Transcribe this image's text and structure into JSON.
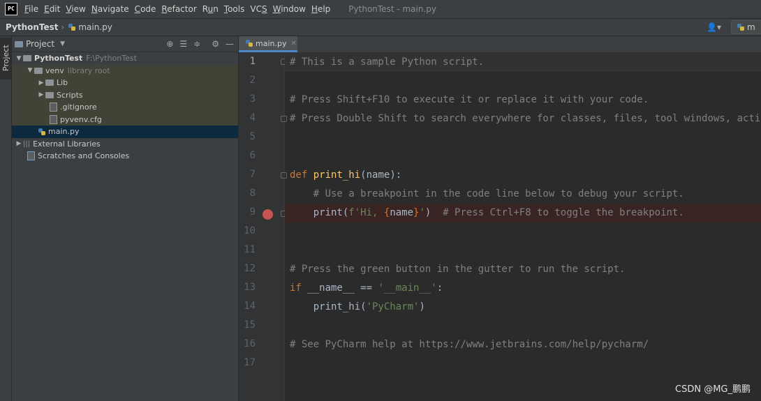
{
  "app": {
    "logo": "PC",
    "window_title": "PythonTest - main.py"
  },
  "menu": [
    {
      "label": "File",
      "mnemonic": "F"
    },
    {
      "label": "Edit",
      "mnemonic": "E"
    },
    {
      "label": "View",
      "mnemonic": "V"
    },
    {
      "label": "Navigate",
      "mnemonic": "N"
    },
    {
      "label": "Code",
      "mnemonic": "C"
    },
    {
      "label": "Refactor",
      "mnemonic": "R"
    },
    {
      "label": "Run",
      "mnemonic": "u"
    },
    {
      "label": "Tools",
      "mnemonic": "T"
    },
    {
      "label": "VCS",
      "mnemonic": "S"
    },
    {
      "label": "Window",
      "mnemonic": "W"
    },
    {
      "label": "Help",
      "mnemonic": "H"
    }
  ],
  "breadcrumb": {
    "project": "PythonTest",
    "file": "main.py"
  },
  "nav_right": {
    "user_icon": "user-icon",
    "run_config_partial": "m"
  },
  "stripe": {
    "project_tab": "Project"
  },
  "project_panel": {
    "title": "Project",
    "tools": [
      "target-icon",
      "expand-all-icon",
      "collapse-all-icon",
      "gear-icon",
      "hide-icon"
    ],
    "tree": [
      {
        "label": "PythonTest",
        "extra": "F:\\PythonTest",
        "kind": "folder",
        "bold": true
      },
      {
        "label": "venv",
        "extra": "library root",
        "kind": "folder"
      },
      {
        "label": "Lib",
        "kind": "folder"
      },
      {
        "label": "Scripts",
        "kind": "folder"
      },
      {
        "label": ".gitignore",
        "kind": "file"
      },
      {
        "label": "pyvenv.cfg",
        "kind": "file"
      },
      {
        "label": "main.py",
        "kind": "py"
      },
      {
        "label": "External Libraries",
        "kind": "libraries"
      },
      {
        "label": "Scratches and Consoles",
        "kind": "scratches"
      }
    ]
  },
  "editor": {
    "tab_label": "main.py",
    "line_numbers": [
      "1",
      "2",
      "3",
      "4",
      "5",
      "6",
      "7",
      "8",
      "9",
      "10",
      "11",
      "12",
      "13",
      "14",
      "15",
      "16",
      "17"
    ],
    "breakpoint_line": 9,
    "lines": {
      "l1": "# This is a sample Python script.",
      "l3": "# Press Shift+F10 to execute it or replace it with your code.",
      "l4": "# Press Double Shift to search everywhere for classes, files, tool windows, actions, and settings.",
      "l7_kw": "def",
      "l7_fn": "print_hi",
      "l7_rest": "(name):",
      "l8": "    # Use a breakpoint in the code line below to debug your script.",
      "l9_call": "    print(",
      "l9_str1": "f'Hi, ",
      "l9_brace_open": "{",
      "l9_var": "name",
      "l9_brace_close": "}",
      "l9_str2": "'",
      "l9_close": ")",
      "l9_comment": "  # Press Ctrl+F8 to toggle the breakpoint.",
      "l12": "# Press the green button in the gutter to run the script.",
      "l13_kw": "if",
      "l13_dunder": " __name__",
      "l13_op": " == ",
      "l13_str": "'__main__'",
      "l13_colon": ":",
      "l14_call": "    print_hi(",
      "l14_str": "'PyCharm'",
      "l14_close": ")",
      "l16": "# See PyCharm help at https://www.jetbrains.com/help/pycharm/"
    }
  },
  "watermark": "CSDN @MG_鹏鹏"
}
